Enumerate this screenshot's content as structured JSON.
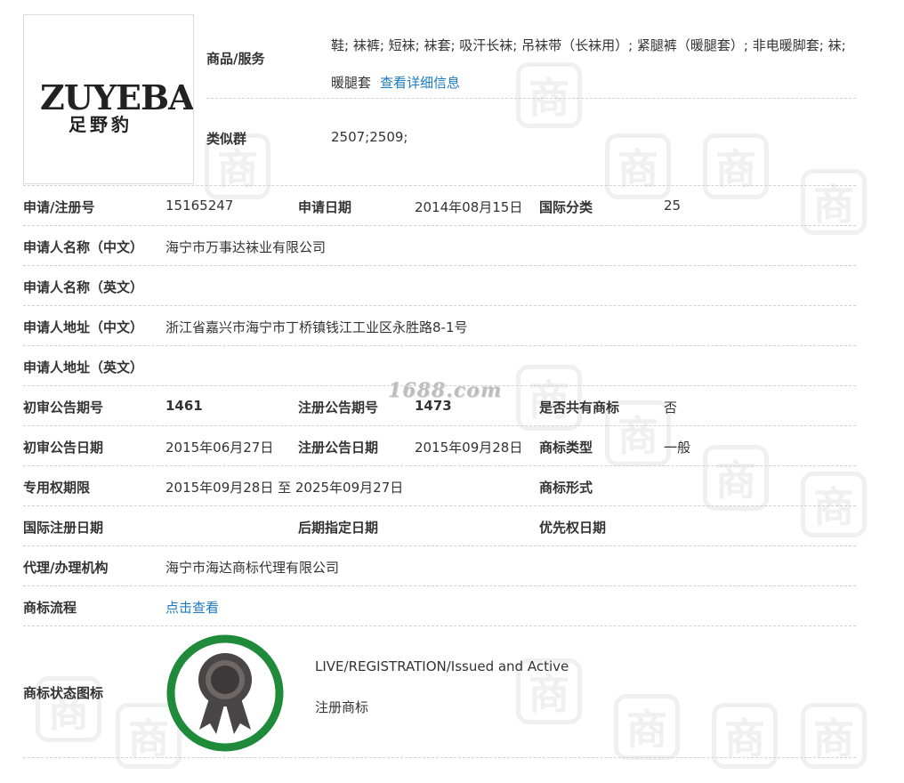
{
  "top": {
    "logo": {
      "text_en": "ZUYEBAO",
      "text_cn": "足野豹"
    },
    "goods": {
      "label": "商品/服务",
      "value": "鞋; 袜裤; 短袜; 袜套; 吸汗长袜; 吊袜带（长袜用）; 紧腿裤（暖腿套）; 非电暖脚套; 袜; 暖腿套",
      "link": "查看详细信息"
    },
    "similar": {
      "label": "类似群",
      "value": "2507;2509;"
    }
  },
  "rows": {
    "reg_no_label": "申请/注册号",
    "reg_no": "15165247",
    "apply_date_label": "申请日期",
    "apply_date": "2014年08月15日",
    "intl_class_label": "国际分类",
    "intl_class": "25",
    "applicant_cn_label": "申请人名称（中文）",
    "applicant_cn": "海宁市万事达袜业有限公司",
    "applicant_en_label": "申请人名称（英文）",
    "address_cn_label": "申请人地址（中文）",
    "address_cn": "浙江省嘉兴市海宁市丁桥镇钱江工业区永胜路8-1号",
    "address_en_label": "申请人地址（英文）",
    "prelim_issue_label": "初审公告期号",
    "prelim_issue": "1461",
    "reg_issue_label": "注册公告期号",
    "reg_issue": "1473",
    "shared_label": "是否共有商标",
    "shared": "否",
    "prelim_date_label": "初审公告日期",
    "prelim_date": "2015年06月27日",
    "reg_date_label": "注册公告日期",
    "reg_date": "2015年09月28日",
    "tm_type_label": "商标类型",
    "tm_type": "一般",
    "exclusive_label": "专用权期限",
    "exclusive": "2015年09月28日 至 2025年09月27日",
    "tm_form_label": "商标形式",
    "intl_reg_date_label": "国际注册日期",
    "later_date_label": "后期指定日期",
    "priority_label": "优先权日期",
    "agent_label": "代理/办理机构",
    "agent": "海宁市海达商标代理有限公司",
    "process_label": "商标流程",
    "process_link": "点击查看",
    "status_label": "商标状态图标",
    "status_en": "LIVE/REGISTRATION/Issued and Active",
    "status_cn": "注册商标"
  },
  "watermark": {
    "text": "1688.com",
    "glyph": "商"
  },
  "colors": {
    "link": "#1b7ac2",
    "badge_green": "#1e8a3a",
    "badge_dark": "#4a4546"
  }
}
